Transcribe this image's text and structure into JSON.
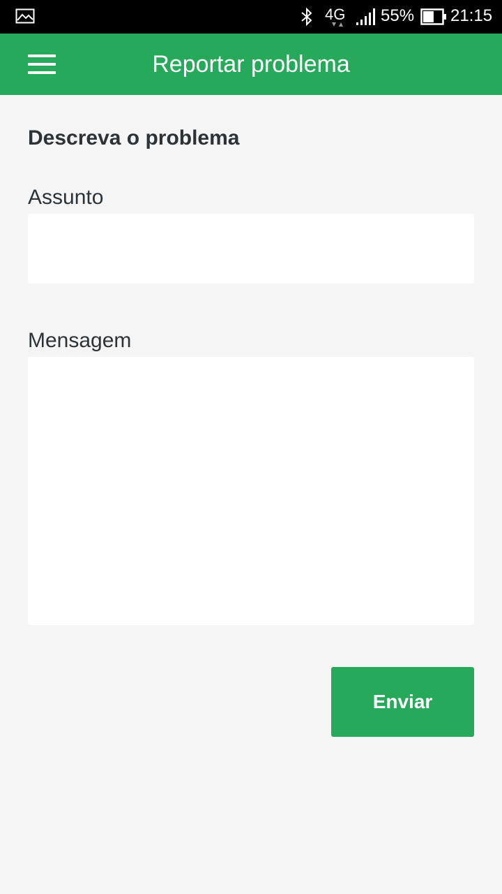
{
  "status_bar": {
    "network": "4G",
    "battery_percent": "55%",
    "battery_level": 0.55,
    "time": "21:15",
    "icons": [
      "gallery-icon",
      "bluetooth-icon",
      "network-arrows-icon",
      "signal-icon",
      "battery-icon"
    ]
  },
  "app_bar": {
    "title": "Reportar problema",
    "menu_icon": "hamburger-menu-icon",
    "background_color": "#27a95c"
  },
  "form": {
    "heading": "Descreva o problema",
    "subject": {
      "label": "Assunto",
      "value": "",
      "placeholder": ""
    },
    "message": {
      "label": "Mensagem",
      "value": "",
      "placeholder": ""
    },
    "submit_label": "Enviar"
  },
  "colors": {
    "accent": "#27a95c",
    "text": "#2c3338",
    "background": "#f5f5f5"
  }
}
